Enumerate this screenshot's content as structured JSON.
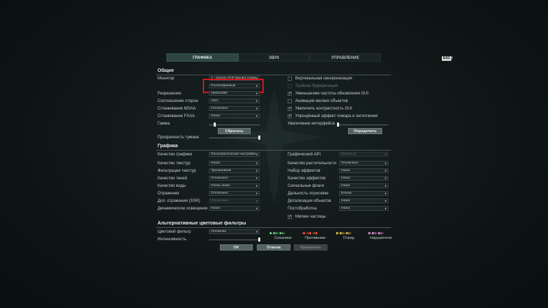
{
  "tabs": {
    "graphics": "ГРАФИКА",
    "sound": "ЗВУК",
    "controls": "УПРАВЛЕНИЕ"
  },
  "esc": {
    "label": "ESC",
    "close": "×"
  },
  "general": {
    "title": "Общие",
    "monitor": {
      "label": "Монитор",
      "value": "1 - Generic PnP Monitor (прим"
    },
    "mode": {
      "value": "Полноэкранный"
    },
    "resolution": {
      "label": "Разрешение",
      "value": "1920x1080"
    },
    "aspect": {
      "label": "Соотношение сторон",
      "value": "Авто"
    },
    "msaa": {
      "label": "Сглаживание MSAA",
      "value": "Отключено"
    },
    "fxaa": {
      "label": "Сглаживание FXAA",
      "value": "Низко"
    },
    "gamma": {
      "label": "Гамма",
      "level": 0.1
    },
    "reset_button": "Сбросить",
    "fog": {
      "label": "Прозрачность тумана",
      "level": 1.0
    },
    "vsync": {
      "label": "Вертикальная синхронизация"
    },
    "triple": {
      "label": "Тройная буферизация"
    },
    "gui_rate": {
      "label": "Уменьшение частоты обновления GUI"
    },
    "small_anim": {
      "label": "Анимация мелких объектов"
    },
    "gui_contrast": {
      "label": "Увеличить контрастность GUI"
    },
    "fire_effect": {
      "label": "Упрощённый эффект пожара и затопления"
    },
    "ui_scale": {
      "label": "Увеличение интерфейса"
    },
    "detect_button": "Определить"
  },
  "graphics": {
    "title": "Графика",
    "quality": {
      "label": "Качество графики",
      "value": "Пользовательские настройки"
    },
    "texture_q": {
      "label": "Качество текстур",
      "value": "Низко"
    },
    "texture_f": {
      "label": "Фильтрация текстур",
      "value": "Трилинейная"
    },
    "shadows": {
      "label": "Качество теней",
      "value": "Отключено"
    },
    "water": {
      "label": "Качество воды",
      "value": "Очень низко"
    },
    "reflections": {
      "label": "Отражения",
      "value": "Отключено"
    },
    "ssr": {
      "label": "Доп. отражения (SSR)",
      "value": "Отключено"
    },
    "dyn_light": {
      "label": "Динамическое освещение",
      "value": "Низко"
    },
    "api": {
      "label": "Графический API",
      "value": "DirectX 11"
    },
    "vegetation": {
      "label": "Качество растительности",
      "value": "Отключено"
    },
    "effects_set": {
      "label": "Набор эффектов",
      "value": "Низко"
    },
    "effects_q": {
      "label": "Качество эффектов",
      "value": "Низко"
    },
    "flags": {
      "label": "Сигнальные флаги",
      "value": "Низко"
    },
    "draw_dist": {
      "label": "Дальность отрисовки",
      "value": "Близко"
    },
    "detail": {
      "label": "Детализация объектов",
      "value": "Низко"
    },
    "post": {
      "label": "Постобработка",
      "value": "Низко"
    },
    "soft_particles": {
      "label": "Мягкие частицы"
    }
  },
  "filters": {
    "title": "Альтернативные цветовые фильтры",
    "color_filter": {
      "label": "Цветовой фильтр",
      "value": "Отключён"
    },
    "intensity": {
      "label": "Интенсивность",
      "level": 1.0
    },
    "legend": {
      "allies": "Союзники",
      "enemies": "Противники",
      "division": "Отряд",
      "violators": "Нарушители"
    },
    "legend_colors": {
      "allies": "#6ee08a",
      "enemies": "#ff5a3c",
      "division": "#f0c84a",
      "violators": "#f098e6"
    }
  },
  "footer": {
    "ok": "OK",
    "cancel": "Отмена",
    "apply": "Применить"
  },
  "glyphs": {
    "check": "✓",
    "arrow": "▾"
  }
}
